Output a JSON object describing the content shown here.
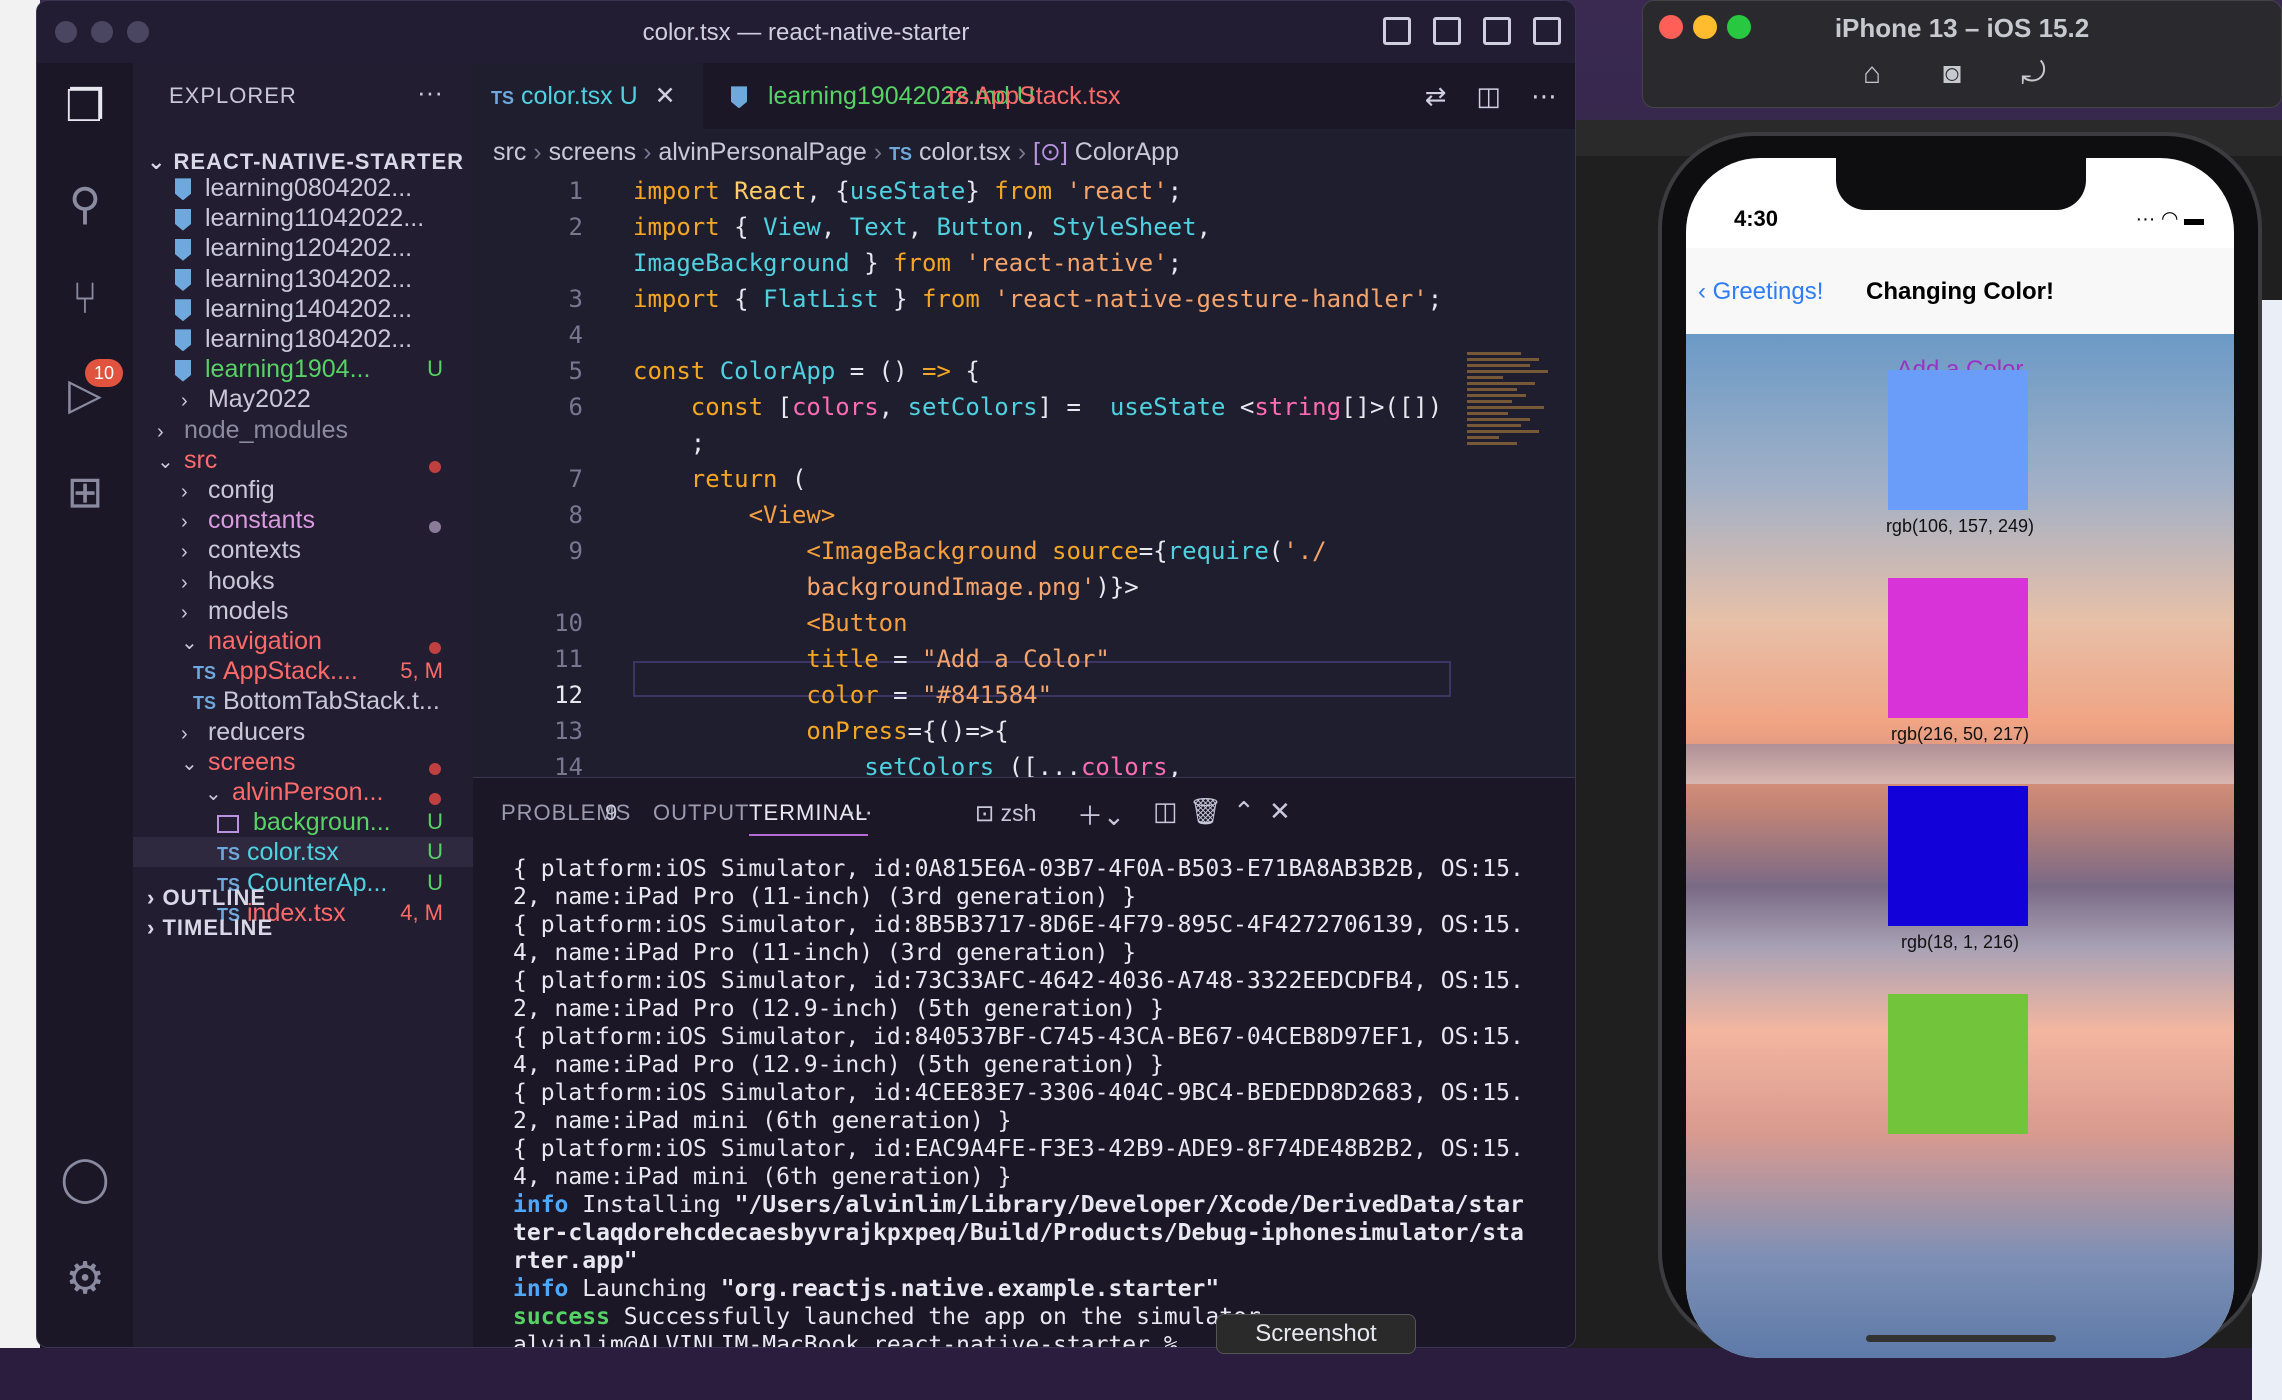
{
  "vscode": {
    "title": "color.tsx — react-native-starter",
    "scm_badge": "10",
    "explorer": {
      "header": "EXPLORER",
      "more": "···",
      "project": "REACT-NATIVE-STARTER",
      "items": [
        {
          "label": "learning0804202...",
          "icon": "markdown-icon"
        },
        {
          "label": "learning11042022...",
          "icon": "markdown-icon"
        },
        {
          "label": "learning1204202...",
          "icon": "markdown-icon"
        },
        {
          "label": "learning1304202...",
          "icon": "markdown-icon"
        },
        {
          "label": "learning1404202...",
          "icon": "markdown-icon"
        },
        {
          "label": "learning1804202...",
          "icon": "markdown-icon"
        },
        {
          "label": "learning1904...",
          "icon": "markdown-icon",
          "status": "U"
        },
        {
          "label": "May2022",
          "icon": "folder"
        },
        {
          "label": "node_modules",
          "icon": "folder"
        },
        {
          "label": "src",
          "icon": "folder-open"
        },
        {
          "label": "config",
          "icon": "folder"
        },
        {
          "label": "constants",
          "icon": "folder"
        },
        {
          "label": "contexts",
          "icon": "folder"
        },
        {
          "label": "hooks",
          "icon": "folder"
        },
        {
          "label": "models",
          "icon": "folder"
        },
        {
          "label": "navigation",
          "icon": "folder-open"
        },
        {
          "label": "AppStack....",
          "icon": "ts",
          "status": "5, M"
        },
        {
          "label": "BottomTabStack.t...",
          "icon": "ts"
        },
        {
          "label": "reducers",
          "icon": "folder"
        },
        {
          "label": "screens",
          "icon": "folder-open"
        },
        {
          "label": "alvinPerson...",
          "icon": "folder-open"
        },
        {
          "label": "backgroun...",
          "icon": "image",
          "status": "U"
        },
        {
          "label": "color.tsx",
          "icon": "ts",
          "status": "U"
        },
        {
          "label": "CounterAp...",
          "icon": "ts",
          "status": "U"
        },
        {
          "label": "index.tsx",
          "icon": "ts",
          "status": "4, M"
        }
      ],
      "outline": "OUTLINE",
      "timeline": "TIMELINE"
    },
    "tabs": [
      {
        "label": "color.tsx",
        "status": "U",
        "prefix": "TS"
      },
      {
        "label": "learning19042022.md",
        "status": "U",
        "prefix": ""
      },
      {
        "label": "AppStack.tsx",
        "status": "5,",
        "prefix": "TS"
      }
    ],
    "breadcrumbs": [
      "src",
      "screens",
      "alvinPersonalPage",
      "color.tsx",
      "ColorApp"
    ],
    "code": [
      {
        "n": "1"
      },
      {
        "n": "2"
      },
      {
        "n": ""
      },
      {
        "n": "3"
      },
      {
        "n": "4"
      },
      {
        "n": "5"
      },
      {
        "n": "6"
      },
      {
        "n": ""
      },
      {
        "n": "7"
      },
      {
        "n": "8"
      },
      {
        "n": "9"
      },
      {
        "n": ""
      },
      {
        "n": "10"
      },
      {
        "n": "11"
      },
      {
        "n": "12"
      },
      {
        "n": "13"
      },
      {
        "n": "14"
      }
    ],
    "panel": {
      "tabs": [
        "PROBLEMS",
        "OUTPUT",
        "TERMINAL"
      ],
      "problems_count": "9",
      "shell": "zsh",
      "more": "···",
      "lines": [
        "{ platform:iOS Simulator, id:0A815E6A-03B7-4F0A-B503-E71BA8AB3B2B, OS:15.",
        "2, name:iPad Pro (11-inch) (3rd generation) }",
        "{ platform:iOS Simulator, id:8B5B3717-8D6E-4F79-895C-4F4272706139, OS:15.",
        "4, name:iPad Pro (11-inch) (3rd generation) }",
        "{ platform:iOS Simulator, id:73C33AFC-4642-4036-A748-3322EEDCDFB4, OS:15.",
        "2, name:iPad Pro (12.9-inch) (5th generation) }",
        "{ platform:iOS Simulator, id:840537BF-C745-43CA-BE67-04CEB8D97EF1, OS:15.",
        "4, name:iPad Pro (12.9-inch) (5th generation) }",
        "{ platform:iOS Simulator, id:4CEE83E7-3306-404C-9BC4-BEDEDD8D2683, OS:15.",
        "2, name:iPad mini (6th generation) }",
        "{ platform:iOS Simulator, id:EAC9A4FE-F3E3-42B9-ADE9-8F74DE48B2B2, OS:15.",
        "4, name:iPad mini (6th generation) }"
      ],
      "info_word": "info",
      "installing": "Installing",
      "install_path_1": "\"/Users/alvinlim/Library/Developer/Xcode/DerivedData/star",
      "install_path_2": "ter-claqdorehcdecaesbyvrajkpxpeq/Build/Products/Debug-iphonesimulator/sta",
      "install_path_3": "rter.app\"",
      "launching": "Launching",
      "launch_id": "\"org.reactjs.native.example.starter\"",
      "success_word": "success",
      "success_text": "Successfully launched the app on the simulator",
      "prompt": "alvinlim@ALVINLIM-MacBook react-native-starter %"
    },
    "screenshot_pill": "Screenshot"
  },
  "simulator": {
    "title": "iPhone 13 – iOS 15.2",
    "time": "4:30",
    "back_label": "Greetings!",
    "nav_title": "Changing Color!",
    "add_button": "Add a Color",
    "button_color": "#841584",
    "swatches": [
      {
        "color": "#6a9df9",
        "label": "rgb(106, 157, 249)"
      },
      {
        "color": "#d832d9",
        "label": "rgb(216, 50, 217)"
      },
      {
        "color": "#1201d8",
        "label": "rgb(18, 1, 216)"
      },
      {
        "color": "#72c43a",
        "label": ""
      }
    ]
  }
}
